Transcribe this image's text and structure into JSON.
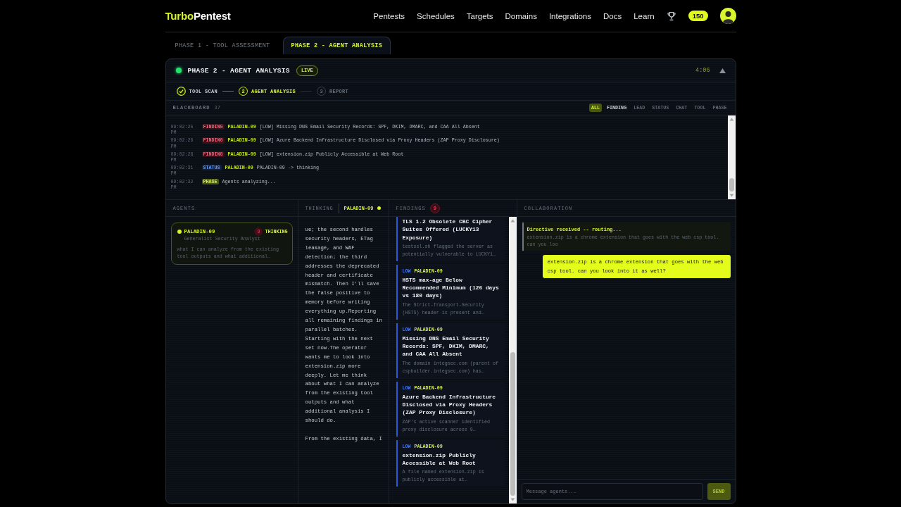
{
  "nav": {
    "logo": {
      "accent": "Turbo",
      "rest": "Pentest"
    },
    "links": [
      "Pentests",
      "Schedules",
      "Targets",
      "Domains",
      "Integrations",
      "Docs",
      "Learn"
    ],
    "points": "150"
  },
  "phase_tabs": [
    {
      "label": "PHASE 1 - TOOL ASSESSMENT",
      "selected": false
    },
    {
      "label": "PHASE 2 - AGENT ANALYSIS",
      "selected": true
    }
  ],
  "phase_panel": {
    "title": "PHASE 2 - AGENT ANALYSIS",
    "running": true,
    "badge": "LIVE",
    "elapsed": "4:06",
    "expanded": true,
    "steps": [
      {
        "label": "TOOL SCAN",
        "completed": true,
        "current": false
      },
      {
        "number": "2",
        "label": "AGENT ANALYSIS",
        "completed": false,
        "current": true
      },
      {
        "number": "3",
        "label": "REPORT",
        "completed": false,
        "current": false
      }
    ]
  },
  "blackboard": {
    "title": "BLACKBOARD",
    "count": "37",
    "filters": [
      {
        "label": "ALL",
        "selected": true,
        "hovered": false
      },
      {
        "label": "FINDING",
        "selected": false,
        "hovered": true
      },
      {
        "label": "LEAD",
        "selected": false,
        "hovered": false
      },
      {
        "label": "STATUS",
        "selected": false,
        "hovered": false
      },
      {
        "label": "CHAT",
        "selected": false,
        "hovered": false
      },
      {
        "label": "TOOL",
        "selected": false,
        "hovered": false
      },
      {
        "label": "PHASE",
        "selected": false,
        "hovered": false
      }
    ],
    "entries": [
      {
        "time": "09:02:25 PM",
        "kind": "finding",
        "tag": "FINDING",
        "agent": "PALADIN-09",
        "message": "[LOW] Missing DNS Email Security Records: SPF, DKIM, DMARC, and CAA All Absent"
      },
      {
        "time": "09:02:26 PM",
        "kind": "finding",
        "tag": "FINDING",
        "agent": "PALADIN-09",
        "message": "[LOW] Azure Backend Infrastructure Disclosed via Proxy Headers (ZAP Proxy Disclosure)"
      },
      {
        "time": "09:02:26 PM",
        "kind": "finding",
        "tag": "FINDING",
        "agent": "PALADIN-09",
        "message": "[LOW] extension.zip Publicly Accessible at Web Root"
      },
      {
        "time": "09:02:31 PM",
        "kind": "status",
        "tag": "STATUS",
        "agent": "PALADIN-09",
        "message": "PALADIN-09 -> thinking"
      },
      {
        "time": "09:02:32 PM",
        "kind": "phase",
        "tag": "PHASE",
        "message": "Agents analyzing..."
      }
    ]
  },
  "agents": {
    "title": "AGENTS",
    "items": [
      {
        "name": "PALADIN-09",
        "role": "Generalist Security Analyst",
        "findings": "9",
        "status": "THINKING",
        "preview": "what I can analyze from the existing tool outputs and what additional…",
        "selected": true
      }
    ]
  },
  "thinking": {
    "title": "THINKING",
    "agent": "PALADIN-09",
    "paragraphs": [
      "ue; the second handles security headers, ETag leakage, and WAF detection; the third addresses the deprecated header and certificate mismatch. Then I'll save the false positive to memory before writing everything up.Reporting all remaining findings in parallel batches. Starting with the next set now.The operator wants me to look into extension.zip more deeply. Let me think about what I can analyze from the existing tool outputs and what additional analysis I should do.",
      "From the existing data, I"
    ]
  },
  "findings": {
    "title": "FINDINGS",
    "count": "9",
    "items": [
      {
        "title": "TLS 1.2 Obsolete CBC Cipher Suites Offered (LUCKY13 Exposure)",
        "summary": "testssl.sh flagged the server as potentially vulnerable to LUCKY1…"
      },
      {
        "severity": "LOW",
        "agent": "PALADIN-09",
        "title": "HSTS max-age Below Recommended Minimum (126 days vs 180 days)",
        "summary": "The Strict-Transport-Security (HSTS) header is present and…"
      },
      {
        "severity": "LOW",
        "agent": "PALADIN-09",
        "title": "Missing DNS Email Security Records: SPF, DKIM, DMARC, and CAA All Absent",
        "summary": "The domain integsec.com (parent of cspbuilder.integsec.com) has…"
      },
      {
        "severity": "LOW",
        "agent": "PALADIN-09",
        "title": "Azure Backend Infrastructure Disclosed via Proxy Headers (ZAP Proxy Disclosure)",
        "summary": "ZAP's active scanner identified proxy disclosure across 9…"
      },
      {
        "severity": "LOW",
        "agent": "PALADIN-09",
        "title": "extension.zip Publicly Accessible at Web Root",
        "summary": "A file named extension.zip is publicly accessible at…"
      }
    ]
  },
  "collaboration": {
    "title": "COLLABORATION",
    "messages": [
      {
        "kind": "system",
        "title": "Directive received -- routing...",
        "text": "extension.zip is a chrome extension that goes with the web csp tool. can you loo"
      },
      {
        "kind": "user",
        "text": "extension.zip is a chrome extension that goes with the web csp tool. can you look into it as well?"
      }
    ],
    "composer": {
      "placeholder": "Message agents...",
      "send": "SEND",
      "send_disabled": true
    }
  }
}
